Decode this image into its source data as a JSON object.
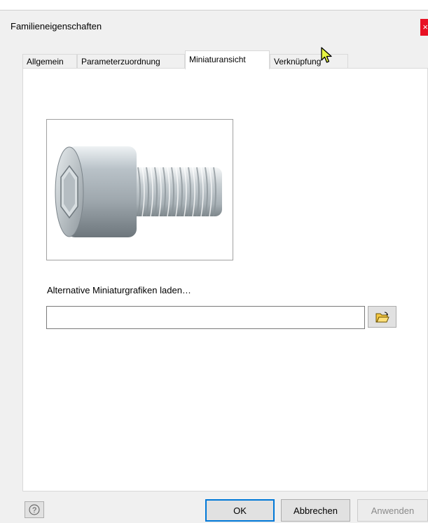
{
  "window": {
    "title": "Familieneigenschaften",
    "close_glyph": "×"
  },
  "tabs": [
    {
      "label": "Allgemein",
      "active": false
    },
    {
      "label": "Parameterzuordnung",
      "active": false
    },
    {
      "label": "Miniaturansicht",
      "active": true
    },
    {
      "label": "Verknüpfung",
      "active": false
    }
  ],
  "thumbnail": {
    "subject": "socket head cap screw",
    "icon": "screw-thumbnail-image"
  },
  "alternate": {
    "label": "Alternative Miniaturgrafiken laden…",
    "path_value": "",
    "browse_icon": "open-folder-icon"
  },
  "footer": {
    "help_icon": "help-icon",
    "ok_label": "OK",
    "cancel_label": "Abbrechen",
    "apply_label": "Anwenden",
    "apply_enabled": false
  },
  "colors": {
    "accent": "#0078d7",
    "close": "#e81123",
    "cursor": "#e6f542"
  }
}
